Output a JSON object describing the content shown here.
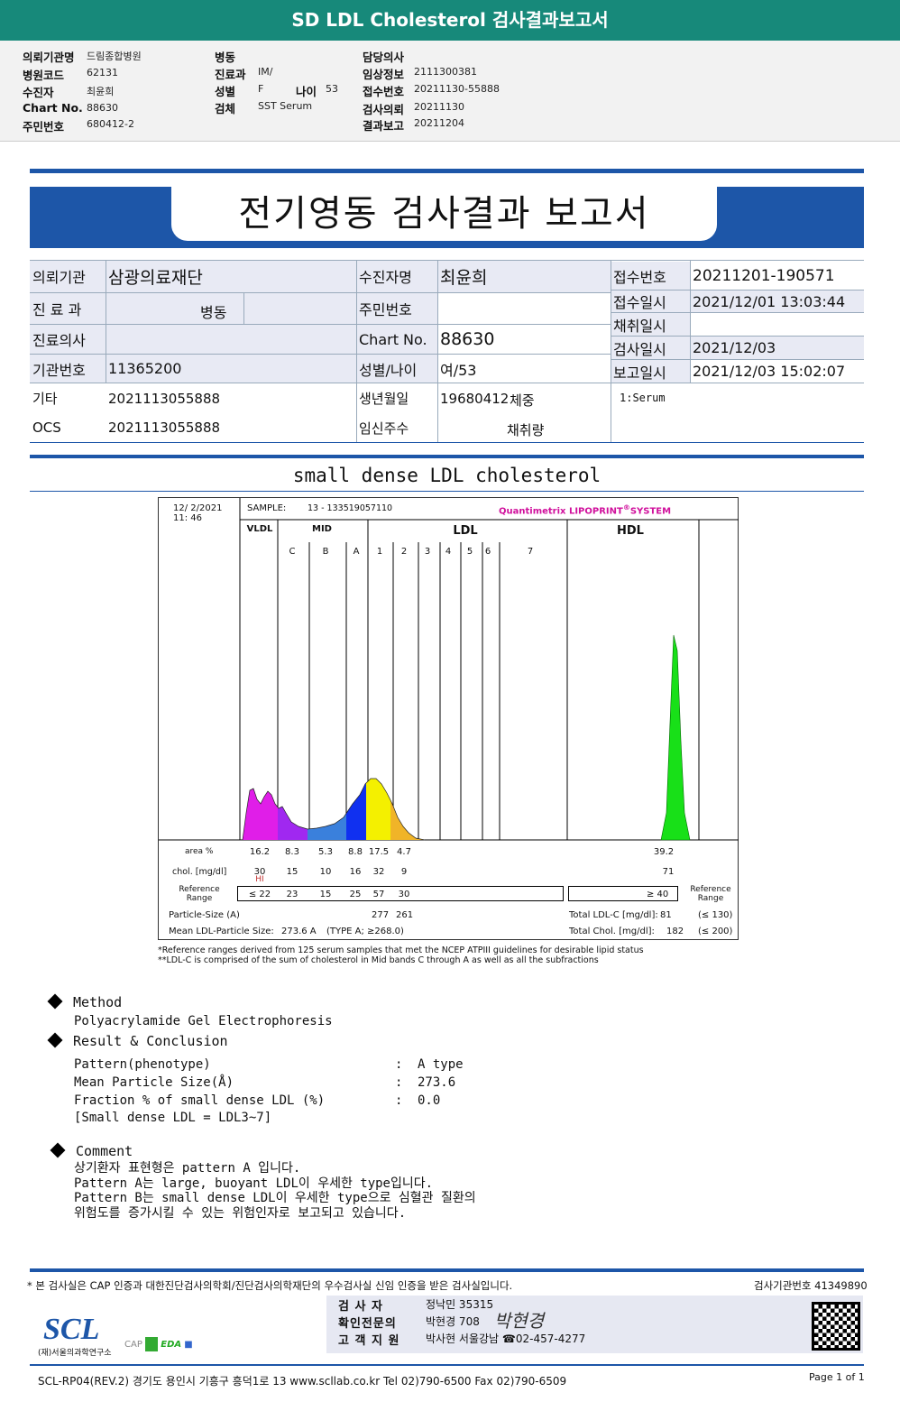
{
  "title": "SD LDL Cholesterol 검사결과보고서",
  "info": {
    "col1": [
      [
        "의뢰기관명",
        "드림종합병원"
      ],
      [
        "병원코드",
        "62131"
      ],
      [
        "수진자",
        "최윤희"
      ],
      [
        "Chart No.",
        "88630"
      ],
      [
        "주민번호",
        "680412-2"
      ]
    ],
    "col2": [
      [
        "병동",
        ""
      ],
      [
        "진료과",
        "IM/"
      ],
      [
        "성별",
        "F"
      ],
      [
        "검체",
        "SST Serum"
      ]
    ],
    "age_label": "나이",
    "age": "53",
    "col3": [
      [
        "담당의사",
        ""
      ],
      [
        "임상정보",
        "2111300381"
      ],
      [
        "접수번호",
        "20211130-55888"
      ],
      [
        "검사의뢰",
        "20211130"
      ],
      [
        "결과보고",
        "20211204"
      ]
    ]
  },
  "report_title": "전기영동 검사결과 보고서",
  "table": {
    "inst_l": "의뢰기관",
    "inst_v": "삼광의료재단",
    "patient_l": "수진자명",
    "patient_v": "최윤희",
    "dept_l": "진 료 과",
    "ward_l": "병동",
    "rrn_l": "주민번호",
    "doctor_l": "진료의사",
    "chart_l": "Chart No.",
    "chart_v": "88630",
    "org_l": "기관번호",
    "org_v": "11365200",
    "sexage_l": "성별/나이",
    "sexage_v": "여/53",
    "etc_l": "기타",
    "etc_v": "2021113055888",
    "birth_l": "생년월일",
    "birth_v": "19680412",
    "weight_l": "체중",
    "ocs_l": "OCS",
    "ocs_v": "2021113055888",
    "preg_l": "임신주수",
    "vol_l": "채취량",
    "right": [
      [
        "접수번호",
        "20211201-190571"
      ],
      [
        "접수일시",
        "2021/12/01  13:03:44"
      ],
      [
        "채취일시",
        ""
      ],
      [
        "검사일시",
        "2021/12/03"
      ],
      [
        "보고일시",
        "2021/12/03  15:02:07"
      ]
    ],
    "specimen": "1:Serum"
  },
  "chart_title": "small dense LDL cholesterol",
  "chart": {
    "date": "12/  2/2021",
    "time": "11:  46",
    "sample_label": "SAMPLE:",
    "sample": "13 - 133519057110",
    "brand": "Quantimetrix LIPOPRINT",
    "brand2": "SYSTEM",
    "groups": [
      "VLDL",
      "MID",
      "LDL",
      "HDL"
    ],
    "bands": [
      "C",
      "B",
      "A",
      "1",
      "2",
      "3",
      "4",
      "5",
      "6",
      "7"
    ],
    "area_label": "area %",
    "area": [
      "16.2",
      "8.3",
      "5.3",
      "8.8",
      "17.5",
      "4.7"
    ],
    "area_hdl": "39.2",
    "chol_label": "chol. [mg/dl]",
    "chol": [
      "30",
      "15",
      "10",
      "16",
      "32",
      "9"
    ],
    "chol_hdl": "71",
    "hi": "HI",
    "ref_label": "Reference Range",
    "ref": [
      "≤ 22",
      "23",
      "15",
      "25",
      "57",
      "30"
    ],
    "ref_hdl": "≥  40",
    "ps_label": "Particle-Size (A)",
    "ps": [
      "277",
      "261"
    ],
    "tldl_label": "Total LDL-C [mg/dl]:",
    "tldl": "81",
    "tldl_ref": "(≤ 130)",
    "mean_label": "Mean LDL-Particle Size:",
    "mean": "273.6  A",
    "mean_type": "(TYPE A; ≥268.0)",
    "tchol_label": "Total Chol. [mg/dl]:",
    "tchol": "182",
    "tchol_ref": "(≤ 200)",
    "colors": {
      "vldl": "#e01ee8",
      "mid_c": "#a028f0",
      "mid_b": "#3a80dc",
      "mid_a": "#1030f0",
      "ldl1": "#f4f000",
      "ldl2": "#f0b428",
      "hdl": "#18e018",
      "brand": "#d0109c"
    }
  },
  "notes": [
    "*Reference ranges derived from 125 serum samples that met the NCEP ATPIII guidelines for desirable lipid status",
    "**LDL-C is comprised of the sum of cholesterol in Mid bands C through A as well as all the subfractions"
  ],
  "method": {
    "title": "Method",
    "text": "Polyacrylamide Gel Electrophoresis"
  },
  "result": {
    "title": "Result & Conclusion",
    "rows": [
      [
        "Pattern(phenotype)",
        "A type"
      ],
      [
        "Mean Particle Size(Å)",
        "273.6"
      ],
      [
        "Fraction % of small dense LDL (%)",
        "0.0"
      ]
    ],
    "note": "[Small dense LDL = LDL3~7]"
  },
  "comment": {
    "title": "Comment",
    "lines": [
      "상기환자 표현형은 pattern A 입니다.",
      "Pattern A는 large, buoyant LDL이 우세한 type입니다.",
      "Pattern B는 small dense LDL이 우세한 type으로 심혈관 질환의",
      "위험도를 증가시킬 수 있는 위험인자로 보고되고 있습니다."
    ]
  },
  "footer": {
    "cert": "* 본 검사실은 CAP 인증과 대한진단검사의학회/진단검사의학재단의 우수검사실 신임 인증을 받은 검사실입니다.",
    "org_no": "검사기관번호  41349890",
    "sig": [
      [
        "검  사  자",
        "정낙민 35315"
      ],
      [
        "확인전문의",
        "박현경 708"
      ],
      [
        "고 객 지 원",
        "박사현 서울강남 ☎02-457-4277"
      ]
    ],
    "logo": "SCL",
    "logo_sub": "(재)서울의과학연구소",
    "bottom": "SCL-RP04(REV.2)  경기도 용인시 기흥구 흥덕1로 13  www.scllab.co.kr  Tel 02)790-6500  Fax 02)790-6509",
    "page": "Page 1 of 1"
  }
}
